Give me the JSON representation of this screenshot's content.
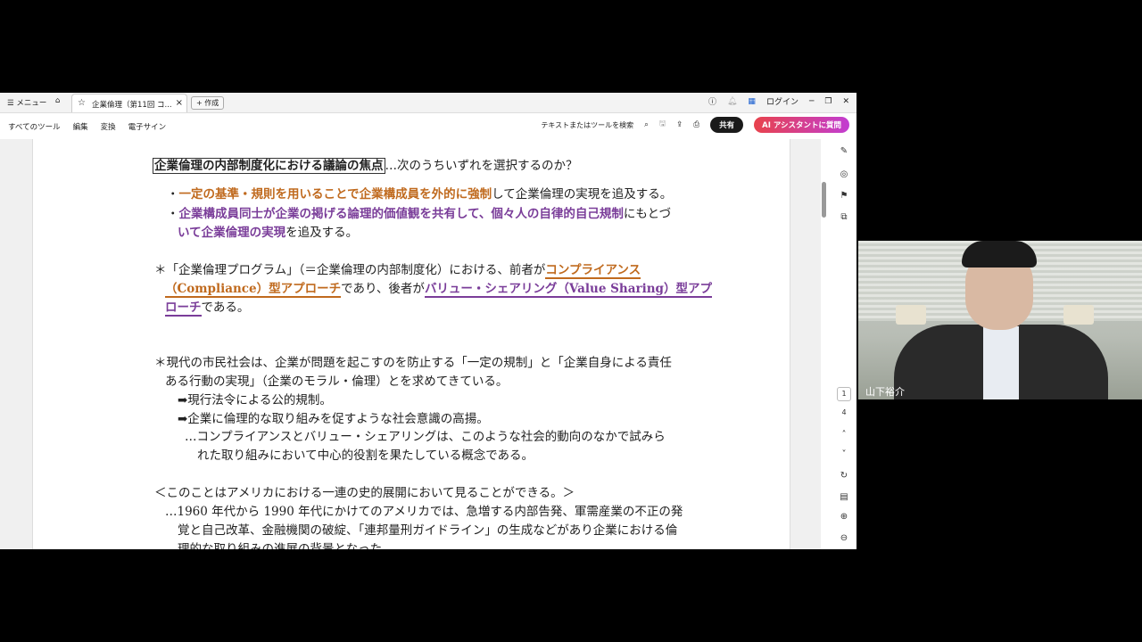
{
  "tabbar": {
    "menu_label": "☰ メニュー",
    "tab_title": "企業倫理（第11回 コ...",
    "new_tab_label": "+ 作成",
    "login_label": "ログイン"
  },
  "toolbar": {
    "items": [
      "すべてのツール",
      "編集",
      "変換",
      "電子サイン"
    ],
    "search_label": "テキストまたはツールを検索",
    "share_label": "共有",
    "ai_label": "AI アシスタントに質問"
  },
  "document": {
    "heading_boxed": "企業倫理の内部制度化における議論の焦点",
    "heading_rest": "…次のうちいずれを選択するのか？",
    "b1_bullet": "・",
    "b1_orange": "一定の基準・規則を用いることで企業構成員を外的に強制",
    "b1_rest": "して企業倫理の実現を追及する。",
    "b2_bullet": "・",
    "b2_purple": "企業構成員同士が企業の掲げる論理的価値観を共有して、個々人の自律的自己規制",
    "b2_rest": "にもとづ",
    "b2_l2_purple": "いて企業倫理の実現",
    "b2_l2_rest": "を追及する。",
    "p1_l1_pre": "＊「企業倫理プログラム」（＝企業倫理の内部制度化）における、前者が",
    "p1_l1_orange": "コンプライアンス",
    "p1_l2_orange": "（Compliance）型アプローチ",
    "p1_l2_mid": "であり、後者が",
    "p1_l2_purple": "バリュー・シェアリング（Value Sharing）型アプ",
    "p1_l3_purple": "ローチ",
    "p1_l3_rest": "である。",
    "p2_l1": "＊現代の市民社会は、企業が問題を起こすのを防止する「一定の規制」と「企業自身による責任",
    "p2_l2": "ある行動の実現」（企業のモラル・倫理）とを求めてきている。",
    "p2_a1": "➡現行法令による公的規制。",
    "p2_a2": "➡企業に倫理的な取り組みを促すような社会意識の高揚。",
    "p2_e1": "…コンプライアンスとバリュー・シェアリングは、このような社会的動向のなかで試みら",
    "p2_e2": "れた取り組みにおいて中心的役割を果たしている概念である。",
    "p3_h": "＜このことはアメリカにおける一連の史的展開において見ることができる。＞",
    "p3_l1": "…1960 年代から 1990 年代にかけてのアメリカでは、急増する内部告発、軍需産業の不正の発",
    "p3_l2": "覚と自己改革、金融機関の破綻、「連邦量刑ガイドライン」の生成などがあり企業における倫",
    "p3_l3": "理的な取り組みの進展の背景となった。"
  },
  "page_nav": {
    "current": "1",
    "total": "4"
  },
  "video": {
    "participant_name": "山下裕介"
  }
}
